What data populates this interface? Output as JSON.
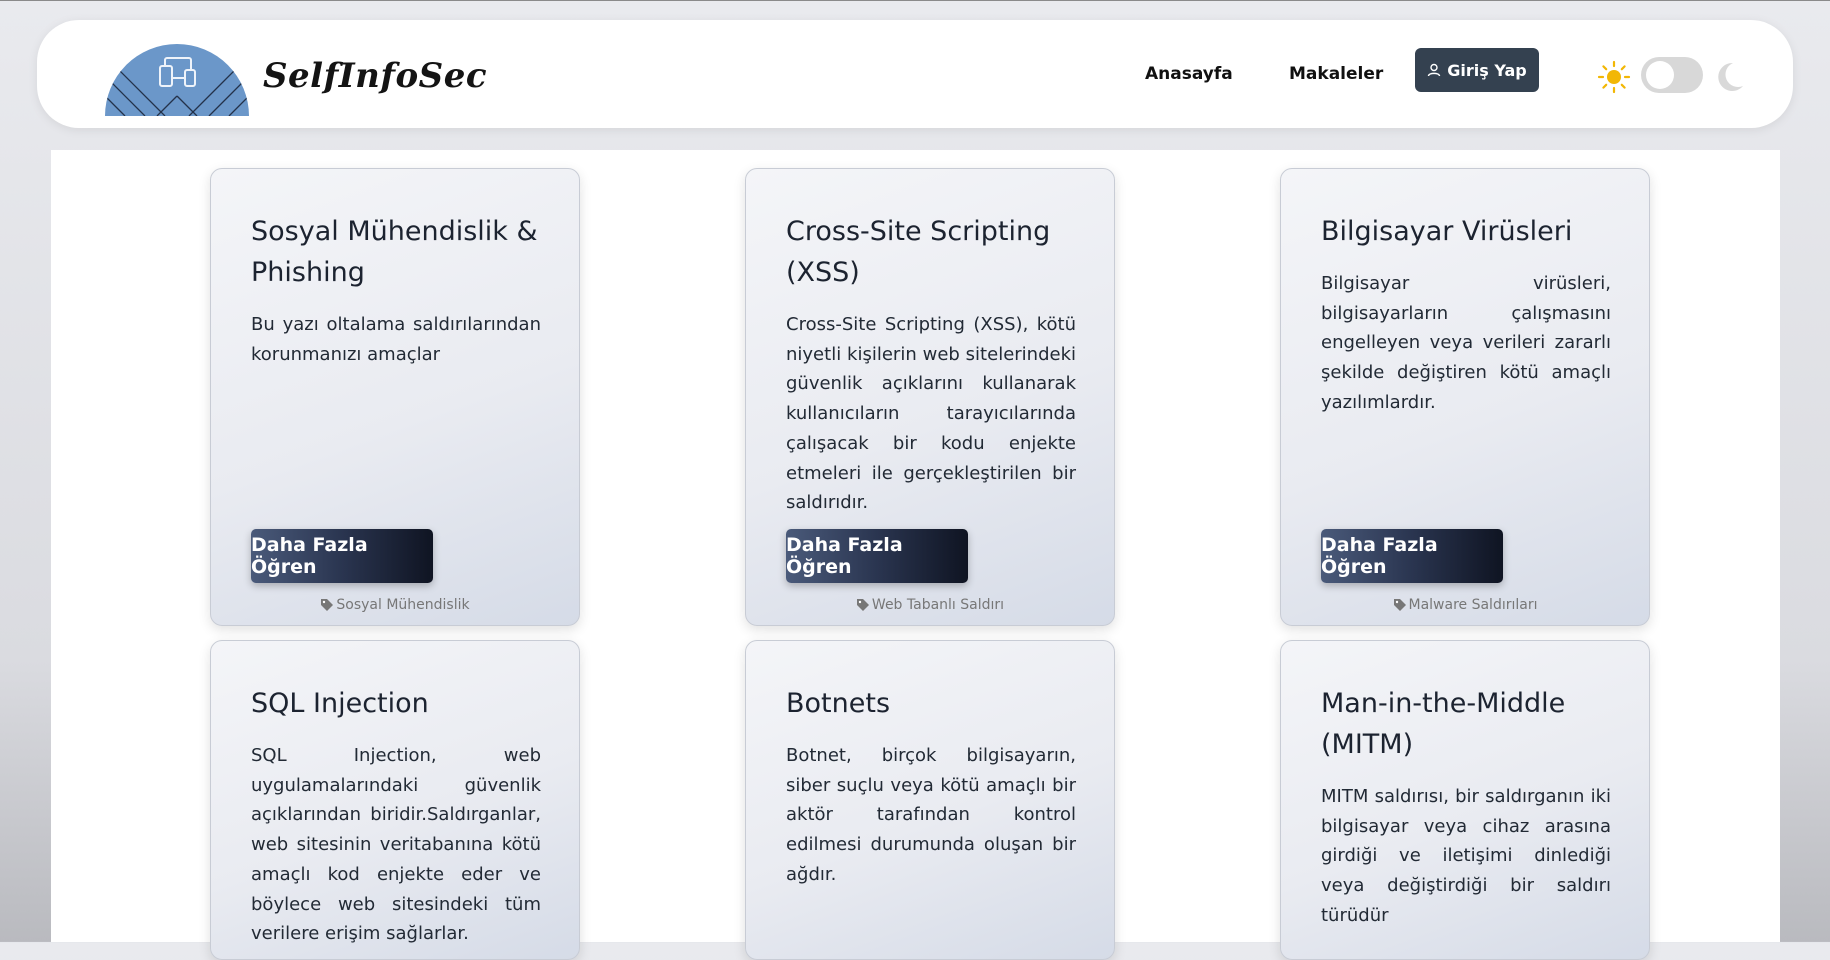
{
  "brand": {
    "name": "SelfInfoSec"
  },
  "nav": {
    "home_label": "Anasayfa",
    "articles_label": "Makaleler",
    "login_label": "Giriş Yap"
  },
  "theme": {
    "light_icon": "sun-icon",
    "dark_icon": "moon-icon",
    "mode": "light"
  },
  "colors": {
    "logo_blue": "#6b97c9",
    "login_bg": "#344150",
    "sun": "#f2b705"
  },
  "cards": [
    {
      "title": "Sosyal Mühendislik & Phishing",
      "text": "Bu yazı oltalama saldırılarından korunmanızı amaçlar",
      "button": "Daha Fazla Öğren",
      "tag": "Sosyal Mühendislik"
    },
    {
      "title": "Cross-Site Scripting (XSS)",
      "text": "Cross-Site Scripting (XSS), kötü niyetli kişilerin web sitelerindeki güvenlik açıklarını kullanarak kullanıcıların tarayıcılarında çalışacak bir kodu enjekte etmeleri ile gerçekleştirilen bir saldırıdır.",
      "button": "Daha Fazla Öğren",
      "tag": "Web Tabanlı Saldırı"
    },
    {
      "title": "Bilgisayar Virüsleri",
      "text": "Bilgisayar virüsleri, bilgisayarların çalışmasını engelleyen veya verileri zararlı şekilde değiştiren kötü amaçlı yazılımlardır.",
      "button": "Daha Fazla Öğren",
      "tag": "Malware Saldırıları"
    },
    {
      "title": "SQL Injection",
      "text": "SQL Injection, web uygulamalarındaki güvenlik açıklarından biridir.Saldırganlar, web sitesinin veritabanına kötü amaçlı kod enjekte eder ve böylece web sitesindeki tüm verilere erişim sağlarlar."
    },
    {
      "title": "Botnets",
      "text": "Botnet, birçok bilgisayarın, siber suçlu veya kötü amaçlı bir aktör tarafından kontrol edilmesi durumunda oluşan bir ağdır."
    },
    {
      "title": "Man-in-the-Middle (MITM)",
      "text": "MITM saldırısı, bir saldırganın iki bilgisayar veya cihaz arasına girdiği ve iletişimi dinlediği veya değiştirdiği bir saldırı türüdür"
    }
  ]
}
